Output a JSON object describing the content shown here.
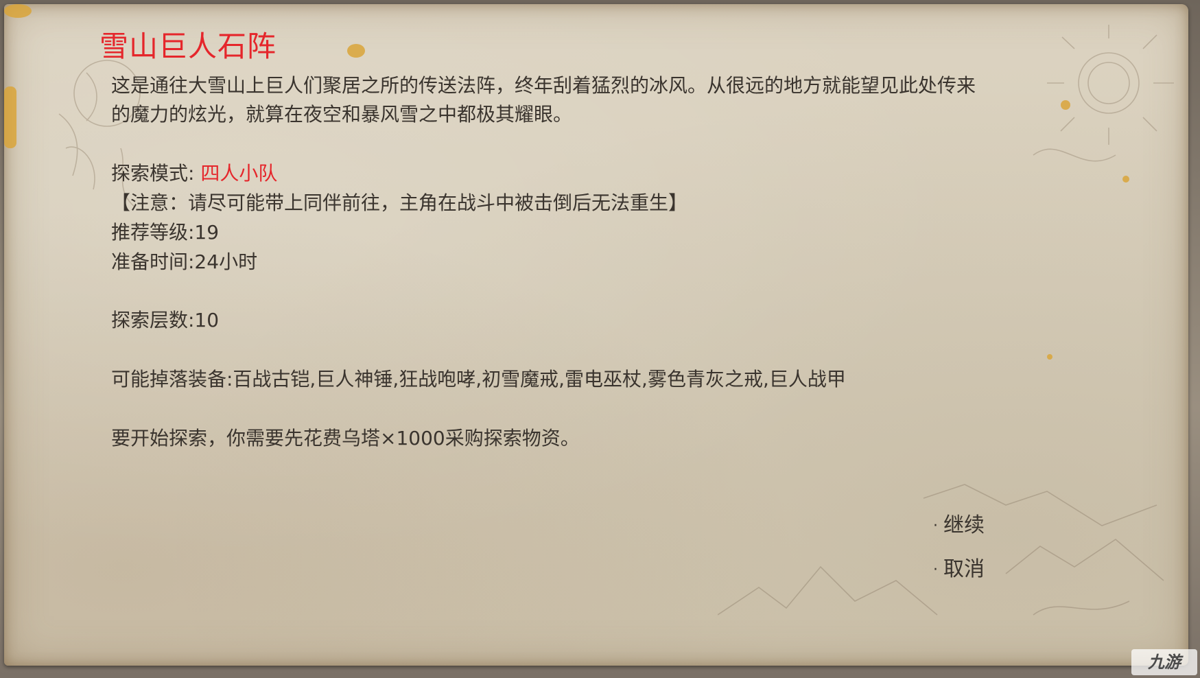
{
  "dialog": {
    "title": "雪山巨人石阵",
    "description_line1": "这是通往大雪山上巨人们聚居之所的传送法阵，终年刮着猛烈的冰风。从很远的地方就能望见此处传来",
    "description_line2": "的魔力的炫光，就算在夜空和暴风雪之中都极其耀眼。",
    "mode_label": "探索模式: ",
    "mode_value": "四人小队",
    "note": "【注意：请尽可能带上同伴前往，主角在战斗中被击倒后无法重生】",
    "recommended_level": "推荐等级:19",
    "prep_time": "准备时间:24小时",
    "floors": "探索层数:10",
    "possible_drops": "可能掉落装备:百战古铠,巨人神锤,狂战咆哮,初雪魔戒,雷电巫杖,雾色青灰之戒,巨人战甲",
    "cost_text": "要开始探索，你需要先花费乌塔×1000采购探索物资。"
  },
  "menu": {
    "bullet": "·",
    "continue_label": "继续",
    "cancel_label": "取消"
  },
  "watermark": {
    "text": "九游"
  },
  "colors": {
    "title_red": "#e5262b",
    "body_text": "#3a342e",
    "paper": "#d6cdb9"
  }
}
